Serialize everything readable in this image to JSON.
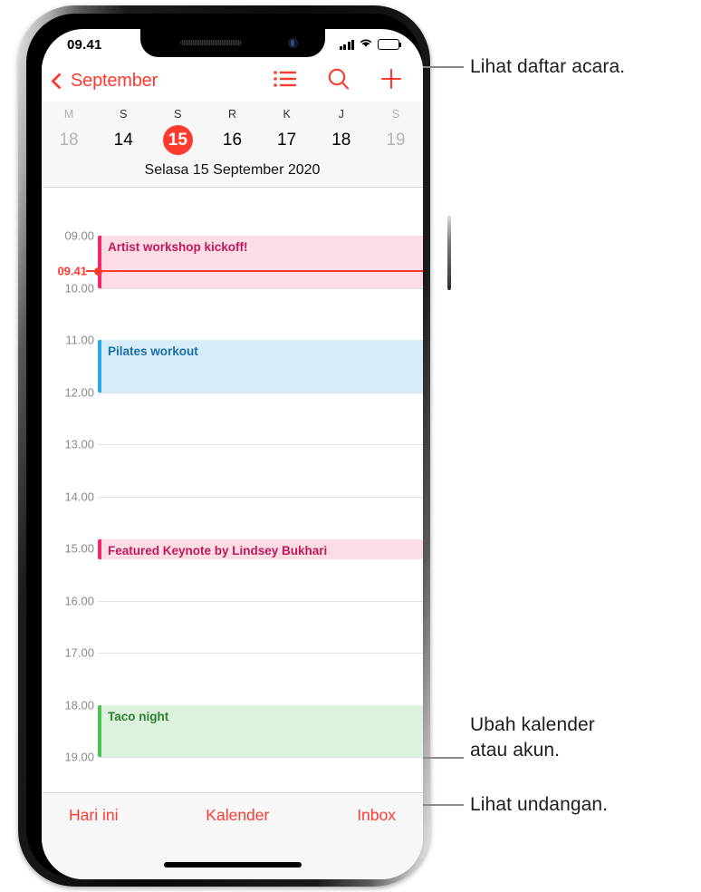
{
  "status_bar": {
    "time": "09.41",
    "signal_icon": "cellular-signal-icon",
    "wifi_icon": "wifi-icon",
    "battery_icon": "battery-icon"
  },
  "nav_bar": {
    "back_label": "September",
    "back_icon": "chevron-left-icon",
    "actions": [
      {
        "name": "list-view-button",
        "icon": "list-bullet-icon"
      },
      {
        "name": "search-button",
        "icon": "search-icon"
      },
      {
        "name": "add-event-button",
        "icon": "plus-icon"
      }
    ]
  },
  "week_strip": {
    "weekday_initials": [
      "M",
      "S",
      "S",
      "R",
      "K",
      "J",
      "S"
    ],
    "days": [
      {
        "num": "18",
        "state": "dim"
      },
      {
        "num": "14",
        "state": "normal"
      },
      {
        "num": "15",
        "state": "today"
      },
      {
        "num": "16",
        "state": "normal"
      },
      {
        "num": "17",
        "state": "normal"
      },
      {
        "num": "18",
        "state": "normal"
      },
      {
        "num": "19",
        "state": "dim"
      }
    ],
    "selected_date": "Selasa  15 September 2020"
  },
  "timeline": {
    "hours": [
      "09.00",
      "10.00",
      "11.00",
      "12.00",
      "13.00",
      "14.00",
      "15.00",
      "16.00",
      "17.00",
      "18.00",
      "19.00"
    ],
    "now_indicator": {
      "label": "09.41",
      "color": "#ff3b30"
    },
    "events": [
      {
        "title": "Artist workshop kickoff!",
        "start": "09.00",
        "end": "10.00",
        "bar_color": "#f5256a",
        "fill_color": "#fcdde6",
        "text_color": "#c2185b"
      },
      {
        "title": "Pilates workout",
        "start": "11.00",
        "end": "12.00",
        "bar_color": "#2aa7e8",
        "fill_color": "#d6ecf8",
        "text_color": "#1b6fa8"
      },
      {
        "title": "Featured Keynote by Lindsey Bukhari",
        "start": "14.50",
        "end": "15.00",
        "bar_color": "#f5256a",
        "fill_color": "#fcdde6",
        "text_color": "#c2185b"
      },
      {
        "title": "Taco night",
        "start": "18.00",
        "end": "19.00",
        "bar_color": "#4cc34c",
        "fill_color": "#ddf2dc",
        "text_color": "#2e7d32"
      }
    ]
  },
  "tab_bar": {
    "items": [
      {
        "name": "tab-today",
        "label": "Hari ini"
      },
      {
        "name": "tab-calendars",
        "label": "Kalender"
      },
      {
        "name": "tab-inbox",
        "label": "Inbox"
      }
    ]
  },
  "callouts": [
    {
      "name": "callout-list-view",
      "text": "Lihat daftar acara."
    },
    {
      "name": "callout-change-calendar",
      "line1": "Ubah kalender",
      "line2": "atau akun."
    },
    {
      "name": "callout-invitations",
      "text": "Lihat undangan."
    }
  ],
  "colors": {
    "accent_red": "#ff3b30",
    "strip_background": "#f7f7f7",
    "grid_line": "#e2e2e2",
    "leader_line": "#8b8b8b"
  }
}
